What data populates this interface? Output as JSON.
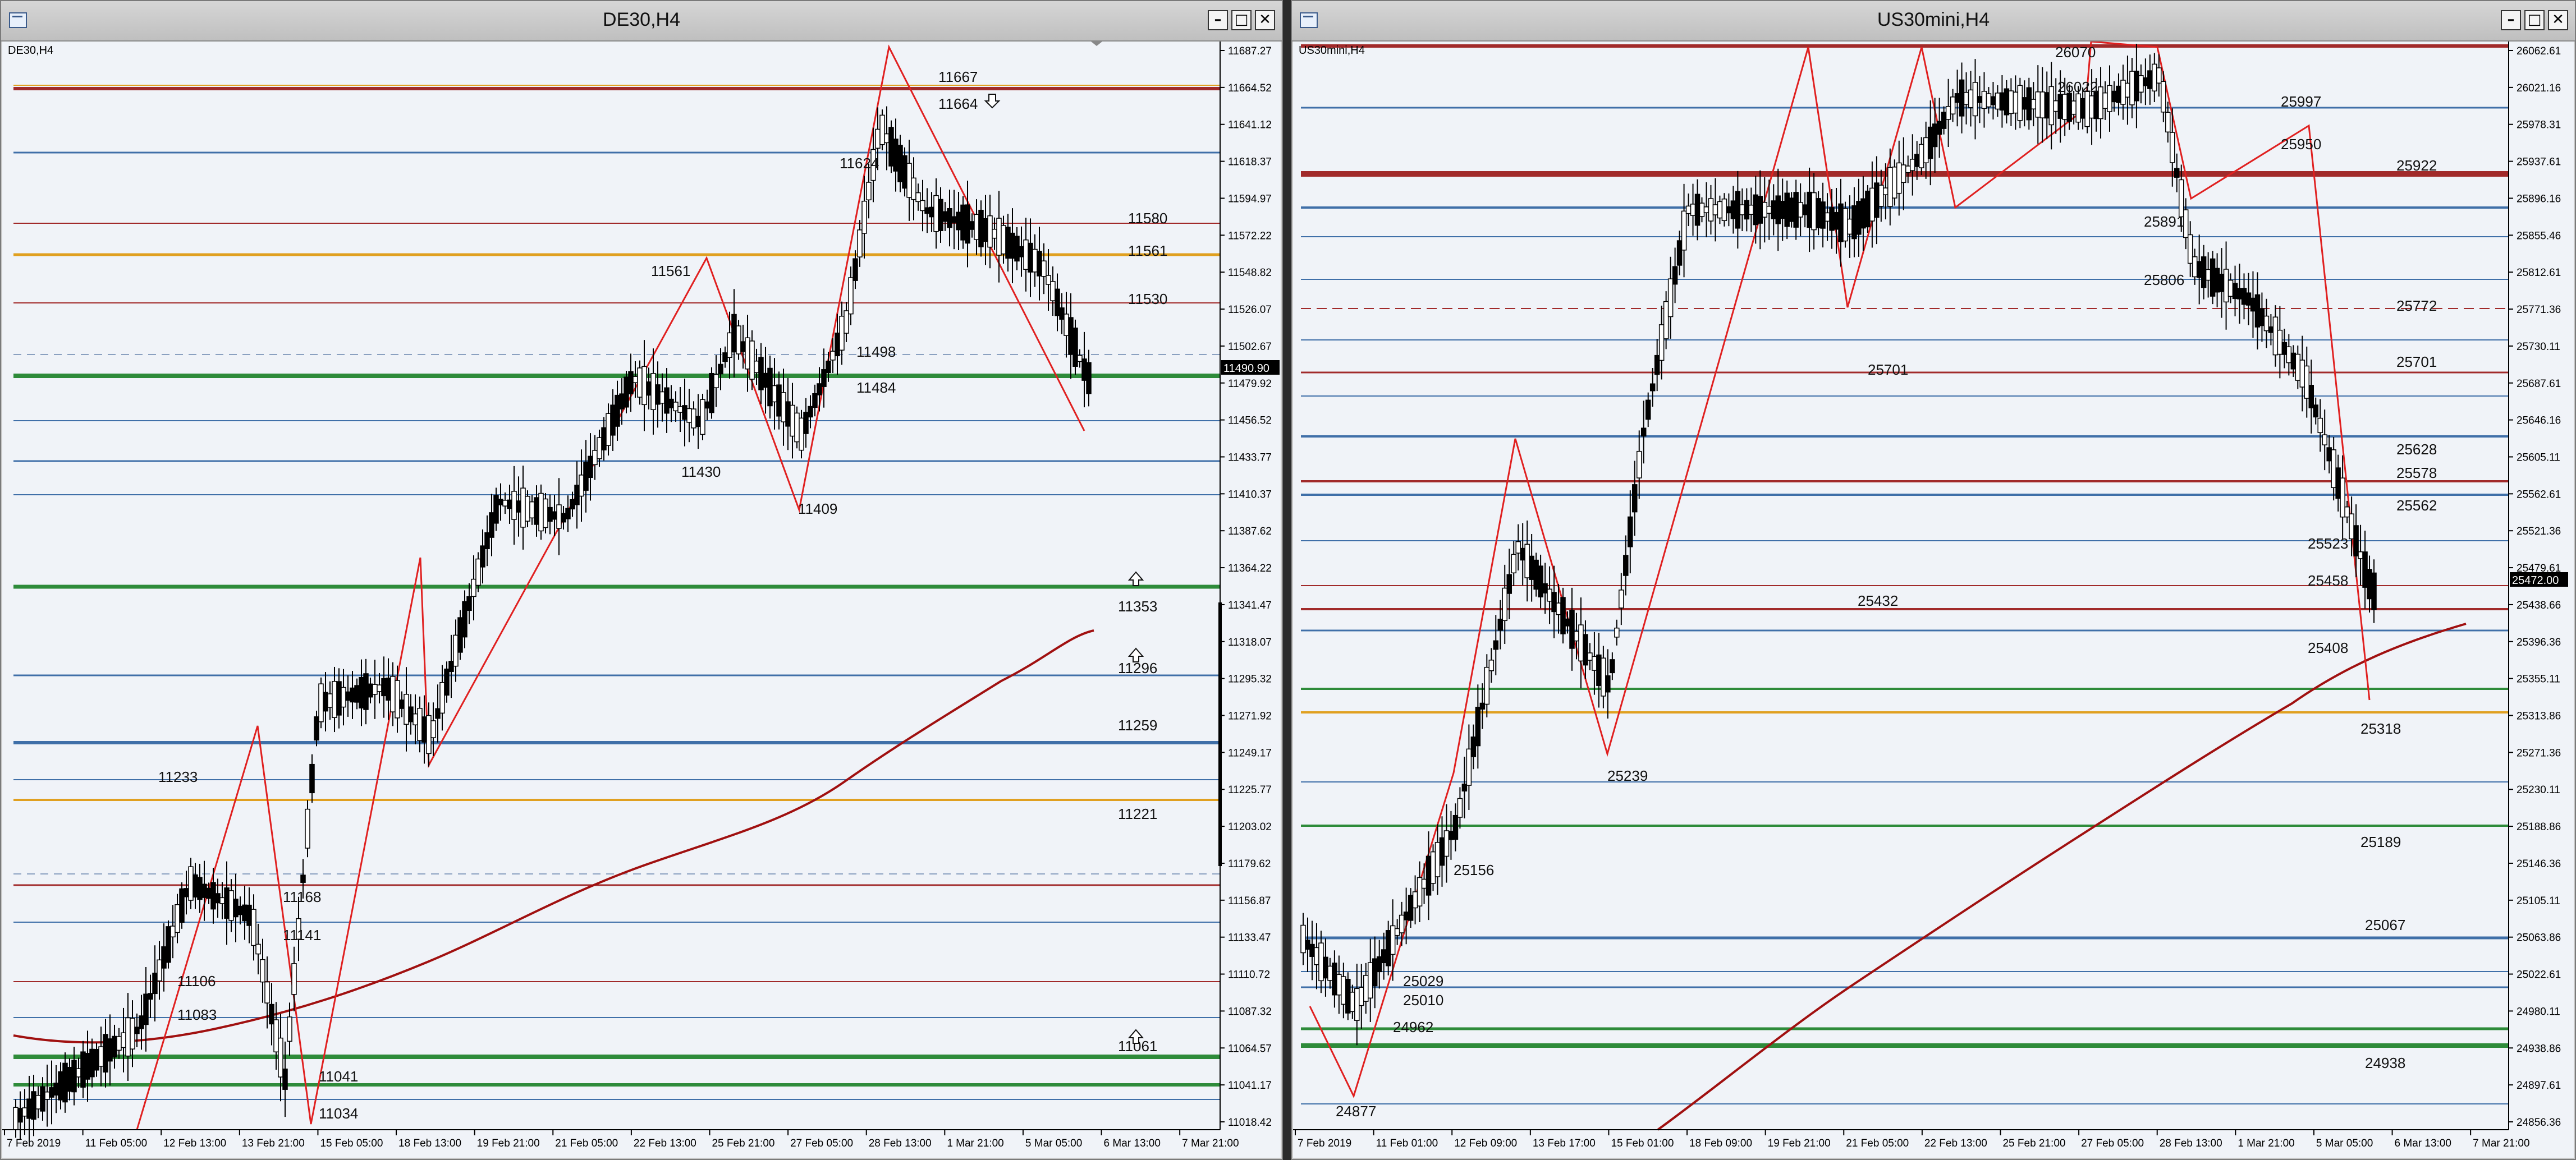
{
  "windows": [
    {
      "title": "DE30,H4",
      "symbol_label": "DE30,H4",
      "current_price": "11490.90",
      "price_scale": [
        "11687.27",
        "11664.52",
        "11641.12",
        "11618.37",
        "11594.97",
        "11572.22",
        "11548.82",
        "11526.07",
        "11502.67",
        "11479.92",
        "11456.52",
        "11433.77",
        "11410.37",
        "11387.62",
        "11364.22",
        "11341.47",
        "11318.07",
        "11295.32",
        "11271.92",
        "11249.17",
        "11225.77",
        "11203.02",
        "11179.62",
        "11156.87",
        "11133.47",
        "11110.72",
        "11087.32",
        "11064.57",
        "11041.17",
        "11018.42"
      ],
      "time_scale": [
        "7 Feb 2019",
        "11 Feb 05:00",
        "12 Feb 13:00",
        "13 Feb 21:00",
        "15 Feb 05:00",
        "18 Feb 13:00",
        "19 Feb 21:00",
        "21 Feb 05:00",
        "22 Feb 13:00",
        "25 Feb 21:00",
        "27 Feb 05:00",
        "28 Feb 13:00",
        "1 Mar 21:00",
        "5 Mar 05:00",
        "6 Mar 13:00",
        "7 Mar 21:00"
      ],
      "labels": [
        "11667",
        "11664",
        "11624",
        "11580",
        "11561",
        "11561",
        "11530",
        "11498",
        "11484",
        "11430",
        "11409",
        "11353",
        "11296",
        "11259",
        "11233",
        "11221",
        "11168",
        "11141",
        "11106",
        "11083",
        "11061",
        "11041",
        "11034"
      ]
    },
    {
      "title": "US30mini,H4",
      "symbol_label": "US30mini,H4",
      "current_price": "25472.00",
      "price_scale": [
        "26062.61",
        "26021.16",
        "25978.31",
        "25937.61",
        "25896.16",
        "25855.46",
        "25812.61",
        "25771.36",
        "25730.11",
        "25687.61",
        "25646.16",
        "25605.11",
        "25562.61",
        "25521.36",
        "25479.61",
        "25438.66",
        "25396.36",
        "25355.11",
        "25313.86",
        "25271.36",
        "25230.11",
        "25188.86",
        "25146.36",
        "25105.11",
        "25063.86",
        "25022.61",
        "24980.11",
        "24938.86",
        "24897.61",
        "24856.36"
      ],
      "time_scale": [
        "7 Feb 2019",
        "11 Feb 01:00",
        "12 Feb 09:00",
        "13 Feb 17:00",
        "15 Feb 01:00",
        "18 Feb 09:00",
        "19 Feb 21:00",
        "21 Feb 05:00",
        "22 Feb 13:00",
        "25 Feb 21:00",
        "27 Feb 05:00",
        "28 Feb 13:00",
        "1 Mar 21:00",
        "5 Mar 05:00",
        "6 Mar 13:00",
        "7 Mar 21:00"
      ],
      "labels": [
        "26070",
        "26022",
        "25997",
        "25950",
        "25922",
        "25891",
        "25806",
        "25772",
        "25701",
        "25701",
        "25628",
        "25578",
        "25562",
        "25523",
        "25458",
        "25432",
        "25408",
        "25318",
        "25239",
        "25189",
        "25156",
        "25067",
        "25029",
        "25010",
        "24962",
        "24938",
        "24877"
      ]
    }
  ],
  "colors": {
    "blue": "#3f6fa8",
    "red": "#a12a2a",
    "green": "#2e8b3a",
    "orange": "#e0a020",
    "ma": "#a01010",
    "zig": "#e02020"
  },
  "icons": [
    "window-icon",
    "minimize-icon",
    "maximize-icon",
    "close-icon",
    "arrow-up-icon",
    "arrow-down-icon"
  ]
}
